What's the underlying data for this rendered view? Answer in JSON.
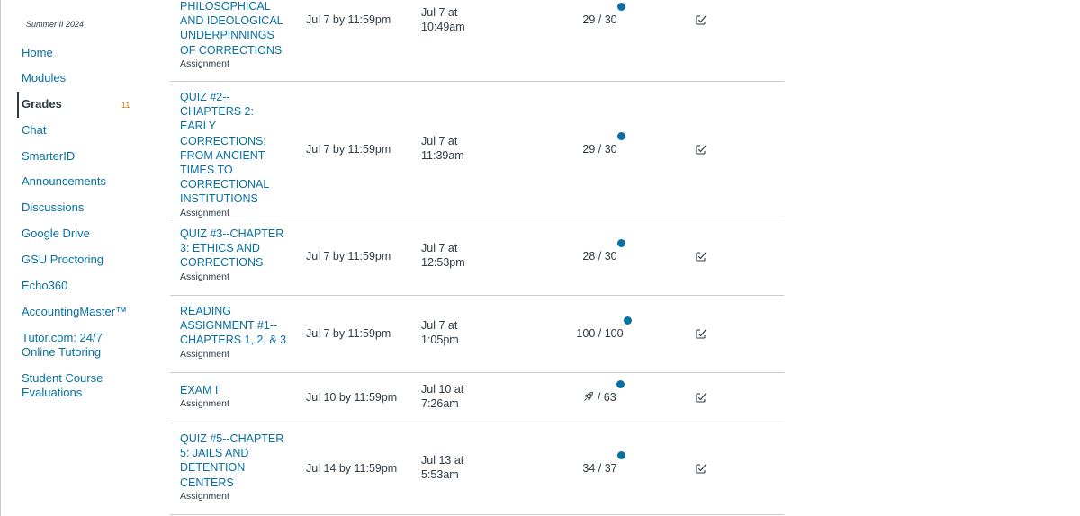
{
  "course": {
    "term": "Summer II 2024"
  },
  "nav": {
    "items": [
      {
        "label": "Home"
      },
      {
        "label": "Modules"
      },
      {
        "label": "Grades",
        "badge": "11"
      },
      {
        "label": "Chat"
      },
      {
        "label": "SmarterID"
      },
      {
        "label": "Announcements"
      },
      {
        "label": "Discussions"
      },
      {
        "label": "Google Drive"
      },
      {
        "label": "GSU Proctoring"
      },
      {
        "label": "Echo360"
      },
      {
        "label": "AccountingMaster™"
      },
      {
        "label": "Tutor.com: 24/7 Online Tutoring"
      },
      {
        "label": "Student Course Evaluations"
      }
    ]
  },
  "colors": {
    "link": "#0770a3",
    "text": "#2d3b45",
    "badge": "#d97900",
    "unread_dot": "#0770a3",
    "divider": "#c7cdd1"
  },
  "assignments": [
    {
      "title_lines": [
        "PHILOSOPHICAL",
        "AND IDEOLOGICAL",
        "UNDERPINNINGS",
        "OF CORRECTIONS"
      ],
      "type": "Assignment",
      "due": "Jul 7 by 11:59pm",
      "submitted": "Jul 7 at 10:49am",
      "score": "29 / 30"
    },
    {
      "title_lines": [
        "QUIZ #2--",
        "CHAPTERS 2: EARLY",
        "CORRECTIONS:",
        "FROM ANCIENT",
        "TIMES TO",
        "CORRECTIONAL",
        "INSTITUTIONS"
      ],
      "type": "Assignment",
      "due": "Jul 7 by 11:59pm",
      "submitted": "Jul 7 at 11:39am",
      "score": "29 / 30"
    },
    {
      "title_lines": [
        "QUIZ #3--CHAPTER",
        "3: ETHICS AND",
        "CORRECTIONS"
      ],
      "type": "Assignment",
      "due": "Jul 7 by 11:59pm",
      "submitted": "Jul 7 at 12:53pm",
      "score": "28 / 30"
    },
    {
      "title_lines": [
        "READING",
        "ASSIGNMENT #1--",
        "CHAPTERS 1, 2, & 3"
      ],
      "type": "Assignment",
      "due": "Jul 7 by 11:59pm",
      "submitted": "Jul 7 at 1:05pm",
      "score": "100 / 100"
    },
    {
      "title_lines": [
        "EXAM I"
      ],
      "type": "Assignment",
      "due": "Jul 10 by 11:59pm",
      "submitted": "Jul 10 at 7:26am",
      "score": "/ 63",
      "score_icon": "rocket-icon"
    },
    {
      "title_lines": [
        "QUIZ #5--CHAPTER",
        "5: JAILS AND",
        "DETENTION",
        "CENTERS"
      ],
      "type": "Assignment",
      "due": "Jul 14 by 11:59pm",
      "submitted": "Jul 13 at 5:53am",
      "score": "34 / 37"
    }
  ]
}
